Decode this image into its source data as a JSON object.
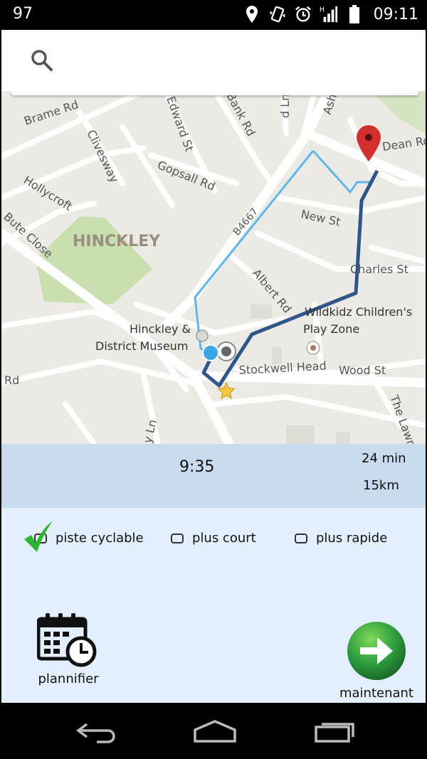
{
  "status_bar": {
    "battery_level_text": "97",
    "time": "09:11",
    "icons": [
      "location-icon",
      "vibrate-icon",
      "alarm-icon",
      "signal-icon",
      "battery-icon"
    ]
  },
  "search": {
    "icon": "search-icon"
  },
  "map": {
    "labels": [
      "Brame Rd",
      "Edward St",
      "Bank Rd",
      "d Ln",
      "Ash",
      "Dean Ro",
      "Clivesway",
      "Gopsall Rd",
      "Hollycroft",
      "Bute Close",
      "HINCKLEY",
      "B4667",
      "New St",
      "Albert Rd",
      "Charles St",
      "Wildkidz Children's",
      "Play Zone",
      "Hinckley &",
      "District Museum",
      "Stockwell Head",
      "Wood St",
      "Rd",
      "y Ln",
      "The Lawn"
    ]
  },
  "trip": {
    "arrival_time": "9:35",
    "duration": "24 min",
    "distance": "15km"
  },
  "options": {
    "bike_path": {
      "label": "piste cyclable",
      "checked": true
    },
    "shortest": {
      "label": "plus court",
      "checked": false
    },
    "fastest": {
      "label": "plus rapide",
      "checked": false
    }
  },
  "actions": {
    "schedule_label": "plannifier",
    "now_label": "maintenant"
  },
  "colors": {
    "route_main": "#2f5688",
    "route_alt": "#5bb8e8",
    "park": "#c9dfb0",
    "pin": "#d32f2f",
    "go_button": "#2e9e3f"
  }
}
